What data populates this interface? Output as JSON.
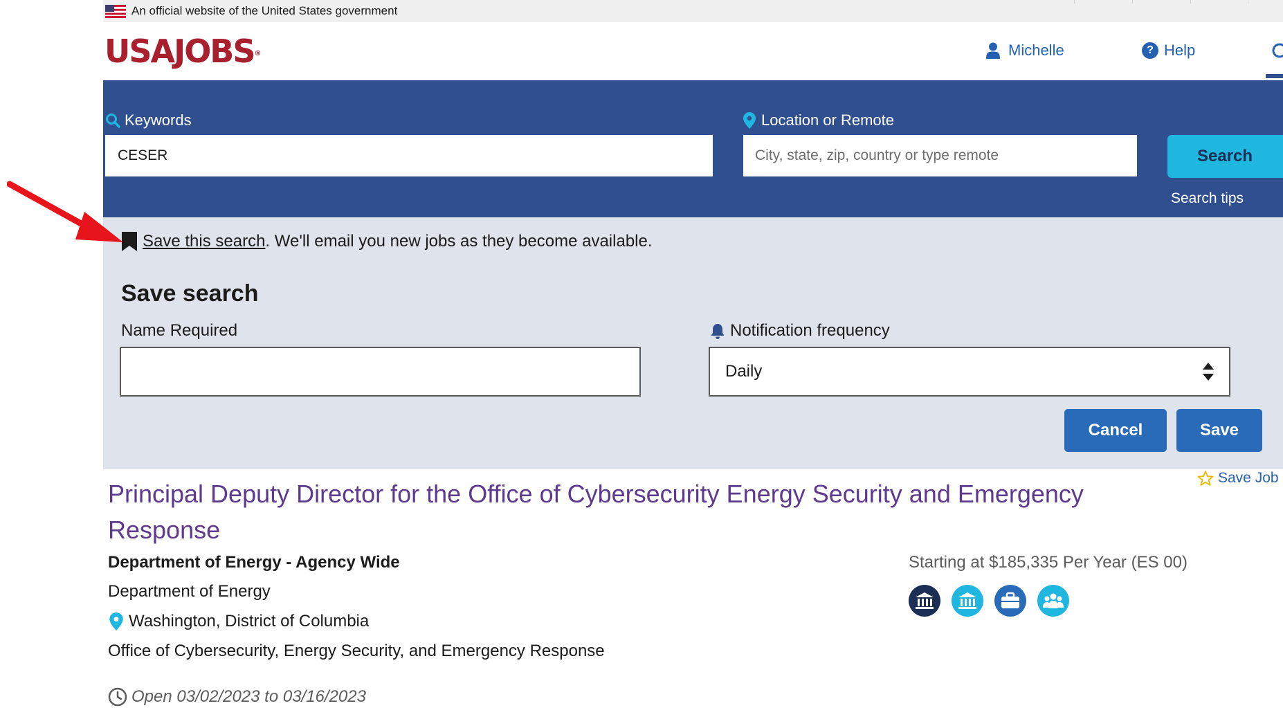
{
  "gov_banner": {
    "text": "An official website of the United States government"
  },
  "header": {
    "logo": "USAJOBS",
    "user_name": "Michelle",
    "help_label": "Help"
  },
  "search": {
    "keywords_label": "Keywords",
    "keywords_value": "CESER",
    "location_label": "Location or Remote",
    "location_placeholder": "City, state, zip, country or type remote",
    "search_button": "Search",
    "search_tips": "Search tips"
  },
  "save_search": {
    "link_text": "Save this search",
    "link_suffix": ". We'll email you new jobs as they become available.",
    "heading": "Save search",
    "name_label": "Name Required",
    "name_value": "",
    "frequency_label": "Notification frequency",
    "frequency_value": "Daily",
    "cancel_button": "Cancel",
    "save_button": "Save"
  },
  "job": {
    "save_job_label": "Save Job",
    "title": "Principal Deputy Director for the Office of Cybersecurity Energy Security and Emergency Response",
    "agency": "Department of Energy - Agency Wide",
    "department": "Department of Energy",
    "location": "Washington, District of Columbia",
    "office": "Office of Cybersecurity, Energy Security, and Emergency Response",
    "open_dates": "Open 03/02/2023 to 03/16/2023",
    "salary": "Starting at $185,335 Per Year (ES 00)",
    "badges": [
      "federal-employees-icon",
      "public-icon",
      "veterans-icon",
      "family-icon"
    ]
  },
  "colors": {
    "brand_red": "#a8202e",
    "search_panel": "#2f4f8f",
    "search_button": "#1fb6e0",
    "save_panel": "#dfe4ec",
    "primary_button": "#2a6bb9",
    "job_title": "#5e3a8f",
    "annotation_arrow": "#e8141b"
  }
}
